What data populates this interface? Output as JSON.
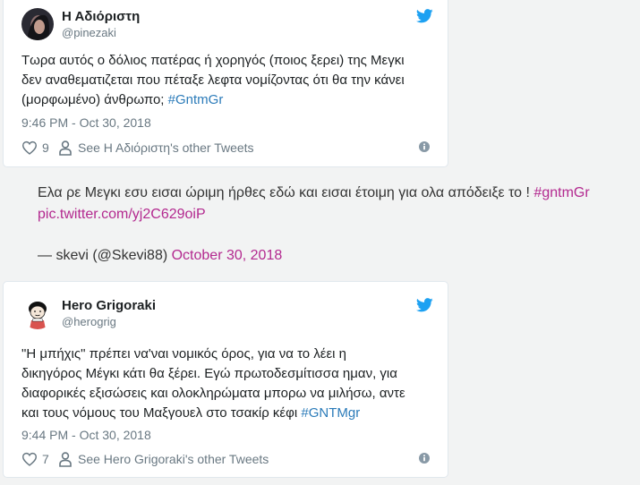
{
  "tweet1": {
    "display_name": "Η Αδιόριστη",
    "handle": "@pinezaki",
    "text_lines": [
      "Τωρα αυτός ο δόλιος πατέρας ή χορηγός (ποιος ξερει) της Μεγκι",
      "δεν αναθεματιζεται που πέταξε λεφτα νομίζοντας ότι θα την κάνει",
      "(μορφωμένο) άνθρωπο; "
    ],
    "hashtag": "#GntmGr",
    "timestamp": "9:46 PM - Oct 30, 2018",
    "like_count": "9",
    "profile_link": "See Η Αδιόριστη's other Tweets"
  },
  "blockquote": {
    "line1_text": "Ελα ρε Μεγκι εσυ εισαι ώριμη ήρθες εδώ και εισαι έτοιμη για ολα απόδειξε το ! ",
    "line1_hashtag": "#gntmGr",
    "pic_link": "pic.twitter.com/yj2C629oiP",
    "attribution": "— skevi (@Skevi88) ",
    "date_link": "October 30, 2018"
  },
  "tweet2": {
    "display_name": "Hero Grigoraki",
    "handle": "@herogrig",
    "text_lines": [
      "\"Η μπήχις\" πρέπει να'ναι νομικός όρος, για να το λέει η",
      "δικηγόρος Μέγκι κάτι θα ξέρει. Εγώ πρωτοδεσμίτισσα ημαν, για",
      "διαφορικές εξισώσεις και ολοκληρώματα μπορω να μιλήσω, αντε",
      "και τους νόμους του Μαξγουελ στο τσακίρ κέφι  "
    ],
    "hashtag": "#GNTMgr",
    "timestamp": "9:44 PM - Oct 30, 2018",
    "like_count": "7",
    "profile_link": "See Hero Grigoraki's other Tweets"
  },
  "colors": {
    "twitter_blue": "#1da1f2",
    "link_blue": "#2b7bb9",
    "muted": "#697882",
    "embed_link": "#b3298f"
  },
  "icons": [
    "twitter-bird-icon",
    "heart-icon",
    "person-icon",
    "info-icon"
  ]
}
